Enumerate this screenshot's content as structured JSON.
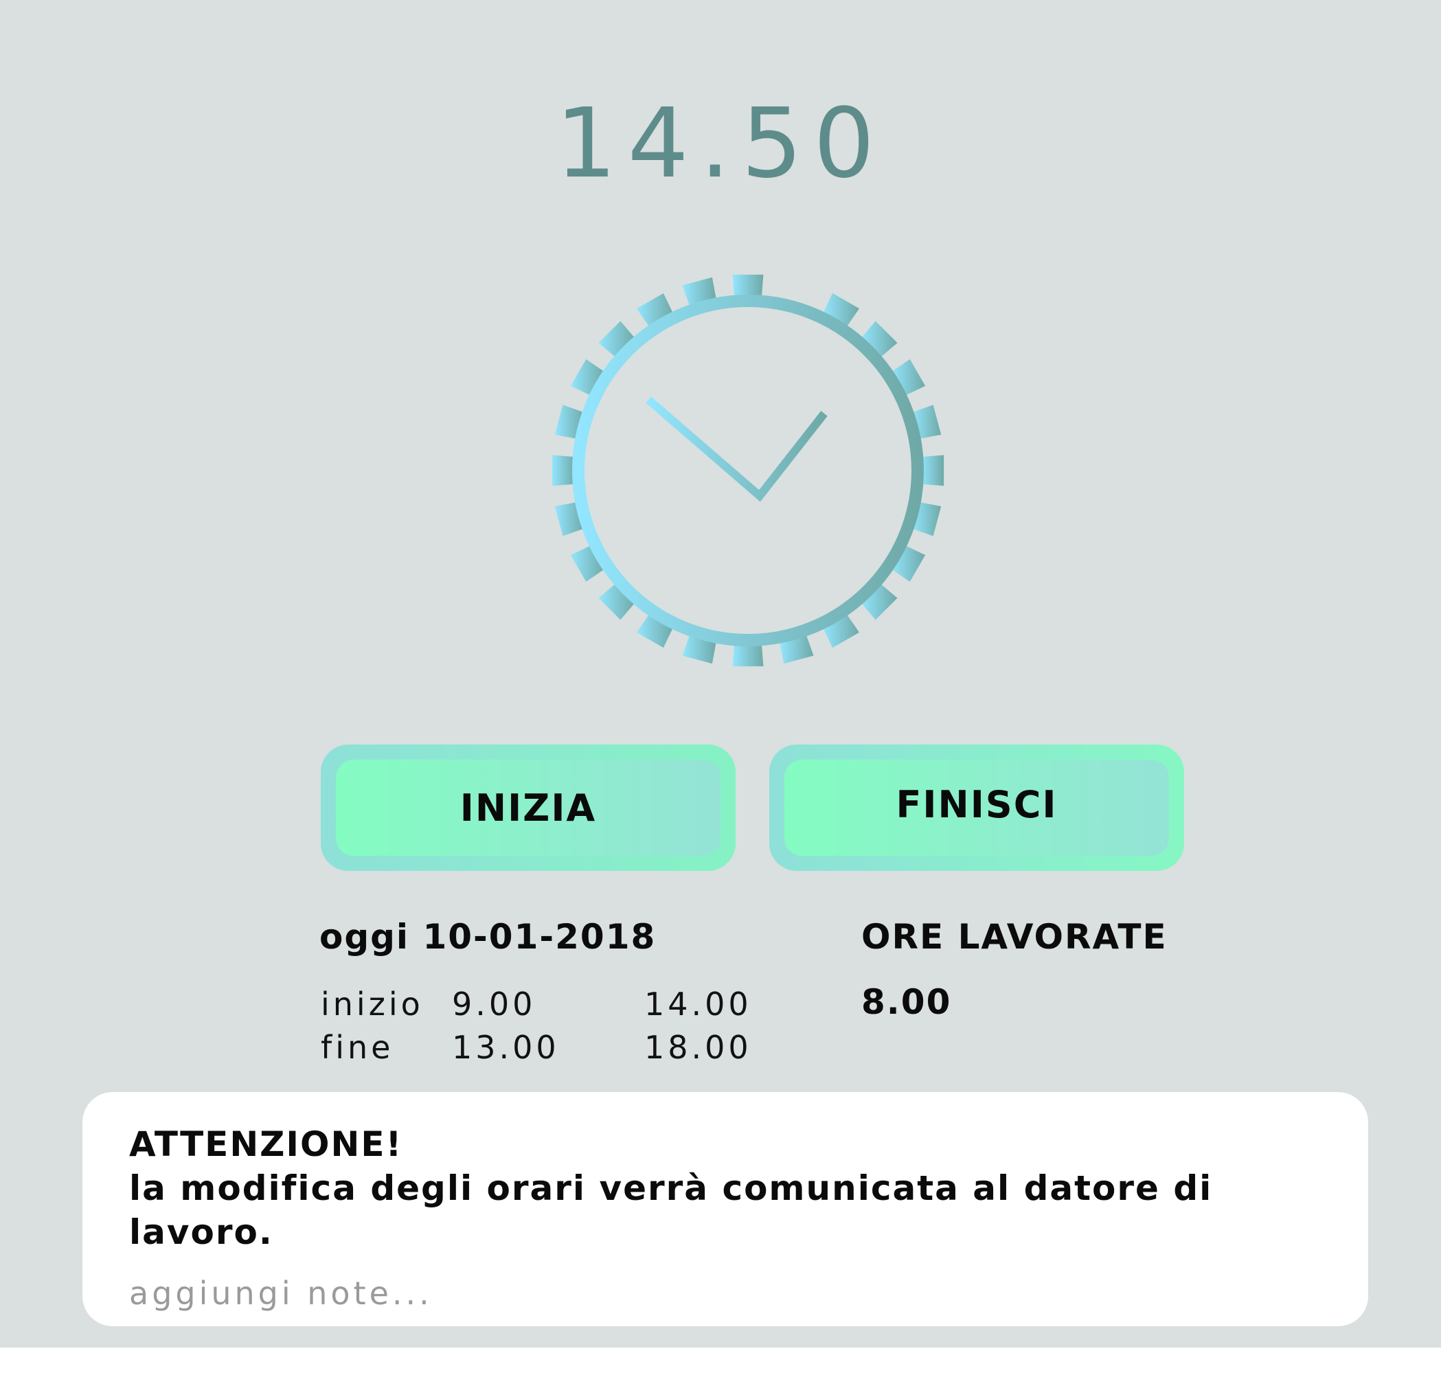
{
  "clock": {
    "time": "14.50",
    "icon": "analog-clock-icon"
  },
  "actions": {
    "start_label": "INIZIA",
    "finish_label": "FINISCI"
  },
  "today": {
    "label": "oggi 10-01-2018",
    "start_label": "inizio",
    "end_label": "fine",
    "shifts": [
      {
        "start": "9.00",
        "end": "13.00"
      },
      {
        "start": "14.00",
        "end": "18.00"
      }
    ]
  },
  "hours": {
    "title": "ORE LAVORATE",
    "value": "8.00"
  },
  "notice": {
    "title": "ATTENZIONE!",
    "message": "la modifica degli orari verrà comunicata al datore di lavoro.",
    "notes_placeholder": "aggiungi note..."
  },
  "colors": {
    "background": "#d9e0df",
    "time_text": "#5e8c8b",
    "clock_light": "#93e6ff",
    "clock_dark": "#6fa9a7",
    "button_green": "#84fcc1",
    "button_teal": "#95e3d6"
  }
}
